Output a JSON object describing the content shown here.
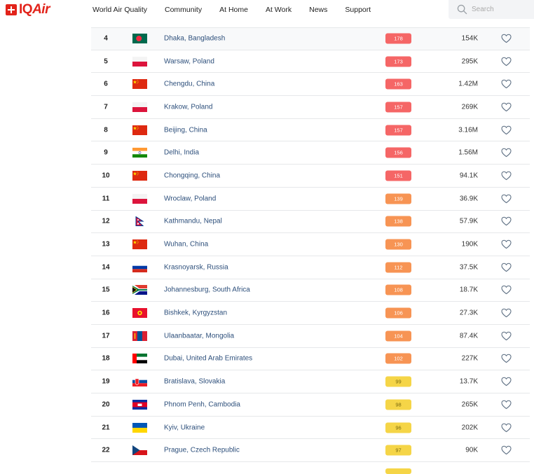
{
  "brand": {
    "name_main": "IQ",
    "name_italic": "Air"
  },
  "nav": [
    {
      "id": "world-air-quality",
      "label": "World Air Quality"
    },
    {
      "id": "community",
      "label": "Community"
    },
    {
      "id": "at-home",
      "label": "At Home"
    },
    {
      "id": "at-work",
      "label": "At Work"
    },
    {
      "id": "news",
      "label": "News"
    },
    {
      "id": "support",
      "label": "Support"
    }
  ],
  "search": {
    "placeholder": "Search"
  },
  "colors": {
    "brand_red": "#e2231a",
    "aqi_unhealthy": "#f56666",
    "aqi_unhealthy_sensitive": "#f79454",
    "aqi_moderate": "#f5d547",
    "city_link": "#2d4f7b"
  },
  "rankings": [
    {
      "rank": "4",
      "country": "bangladesh",
      "city": "Dhaka, Bangladesh",
      "aqi": "178",
      "level": "unhealthy",
      "followers": "154K"
    },
    {
      "rank": "5",
      "country": "poland",
      "city": "Warsaw, Poland",
      "aqi": "173",
      "level": "unhealthy",
      "followers": "295K"
    },
    {
      "rank": "6",
      "country": "china",
      "city": "Chengdu, China",
      "aqi": "163",
      "level": "unhealthy",
      "followers": "1.42M"
    },
    {
      "rank": "7",
      "country": "poland",
      "city": "Krakow, Poland",
      "aqi": "157",
      "level": "unhealthy",
      "followers": "269K"
    },
    {
      "rank": "8",
      "country": "china",
      "city": "Beijing, China",
      "aqi": "157",
      "level": "unhealthy",
      "followers": "3.16M"
    },
    {
      "rank": "9",
      "country": "india",
      "city": "Delhi, India",
      "aqi": "156",
      "level": "unhealthy",
      "followers": "1.56M"
    },
    {
      "rank": "10",
      "country": "china",
      "city": "Chongqing, China",
      "aqi": "151",
      "level": "unhealthy",
      "followers": "94.1K"
    },
    {
      "rank": "11",
      "country": "poland",
      "city": "Wroclaw, Poland",
      "aqi": "139",
      "level": "sensitive",
      "followers": "36.9K"
    },
    {
      "rank": "12",
      "country": "nepal",
      "city": "Kathmandu, Nepal",
      "aqi": "138",
      "level": "sensitive",
      "followers": "57.9K"
    },
    {
      "rank": "13",
      "country": "china",
      "city": "Wuhan, China",
      "aqi": "130",
      "level": "sensitive",
      "followers": "190K"
    },
    {
      "rank": "14",
      "country": "russia",
      "city": "Krasnoyarsk, Russia",
      "aqi": "112",
      "level": "sensitive",
      "followers": "37.5K"
    },
    {
      "rank": "15",
      "country": "south-africa",
      "city": "Johannesburg, South Africa",
      "aqi": "108",
      "level": "sensitive",
      "followers": "18.7K"
    },
    {
      "rank": "16",
      "country": "kyrgyzstan",
      "city": "Bishkek, Kyrgyzstan",
      "aqi": "106",
      "level": "sensitive",
      "followers": "27.3K"
    },
    {
      "rank": "17",
      "country": "mongolia",
      "city": "Ulaanbaatar, Mongolia",
      "aqi": "104",
      "level": "sensitive",
      "followers": "87.4K"
    },
    {
      "rank": "18",
      "country": "uae",
      "city": "Dubai, United Arab Emirates",
      "aqi": "102",
      "level": "sensitive",
      "followers": "227K"
    },
    {
      "rank": "19",
      "country": "slovakia",
      "city": "Bratislava, Slovakia",
      "aqi": "99",
      "level": "moderate",
      "followers": "13.7K"
    },
    {
      "rank": "20",
      "country": "cambodia",
      "city": "Phnom Penh, Cambodia",
      "aqi": "98",
      "level": "moderate",
      "followers": "265K"
    },
    {
      "rank": "21",
      "country": "ukraine",
      "city": "Kyiv, Ukraine",
      "aqi": "96",
      "level": "moderate",
      "followers": "202K"
    },
    {
      "rank": "22",
      "country": "czech",
      "city": "Prague, Czech Republic",
      "aqi": "97",
      "level": "moderate",
      "followers": "90K"
    }
  ]
}
